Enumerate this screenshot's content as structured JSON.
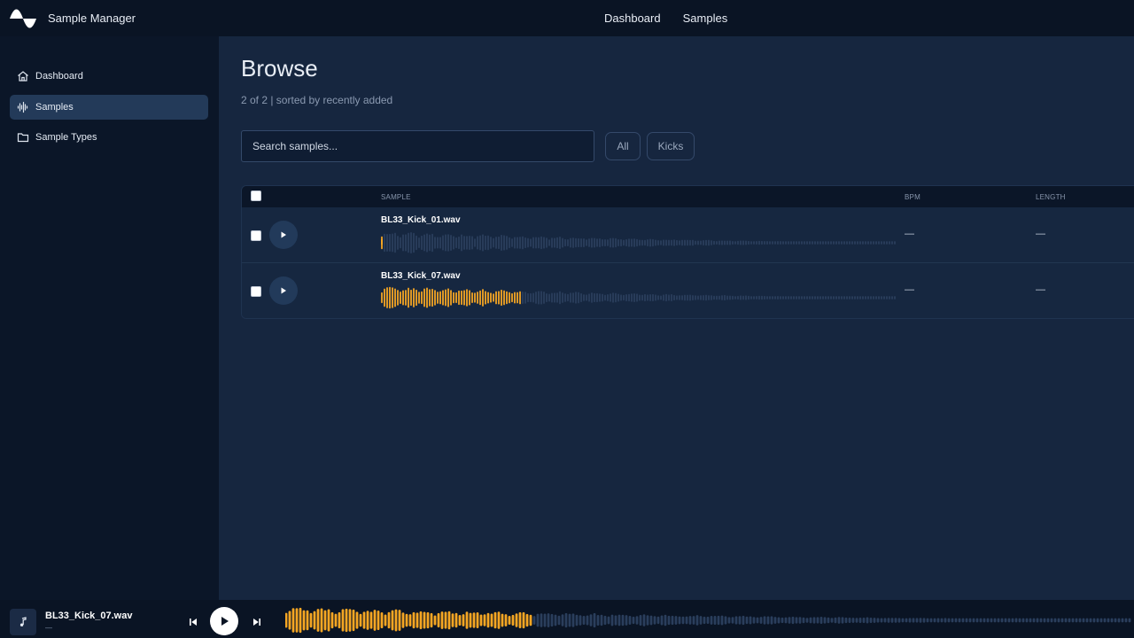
{
  "app": {
    "name": "Sample Manager"
  },
  "topnav": {
    "items": [
      {
        "label": "Dashboard"
      },
      {
        "label": "Samples"
      }
    ]
  },
  "sidebar": {
    "items": [
      {
        "label": "Dashboard",
        "icon": "home-icon",
        "active": false
      },
      {
        "label": "Samples",
        "icon": "waveform-icon",
        "active": true
      },
      {
        "label": "Sample Types",
        "icon": "folder-icon",
        "active": false
      }
    ]
  },
  "main": {
    "title": "Browse",
    "subtitle": "2 of 2 | sorted by recently added",
    "search": {
      "placeholder": "Search samples...",
      "value": ""
    },
    "filters": [
      {
        "label": "All"
      },
      {
        "label": "Kicks"
      }
    ]
  },
  "table": {
    "columns": {
      "sample": "SAMPLE",
      "bpm": "BPM",
      "length": "LENGTH"
    },
    "rows": [
      {
        "name": "BL33_Kick_01.wav",
        "bpm": "—",
        "length": "—",
        "progress": 0.0
      },
      {
        "name": "BL33_Kick_07.wav",
        "bpm": "—",
        "length": "—",
        "progress": 0.27
      }
    ]
  },
  "player": {
    "track": "BL33_Kick_07.wav",
    "sub": "—",
    "progress": 0.29,
    "icons": [
      "music-note-icon",
      "skip-back-icon",
      "play-icon",
      "skip-forward-icon"
    ]
  },
  "colors": {
    "accent": "#f5a623",
    "wave_inactive": "#2a3e5c",
    "panel": "#16263f",
    "sidebar": "#0b1628",
    "active_item": "#233a59"
  }
}
